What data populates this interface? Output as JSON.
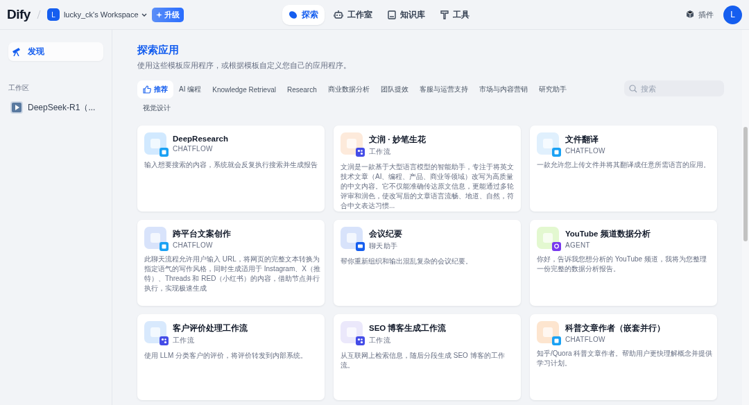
{
  "header": {
    "logo": "Dify",
    "workspace": {
      "initial": "L",
      "name": "lucky_ck's Workspace"
    },
    "upgrade": "升级",
    "nav": [
      {
        "label": "探索",
        "kind": "explore",
        "selected": true
      },
      {
        "label": "工作室",
        "kind": "studio",
        "selected": false
      },
      {
        "label": "知识库",
        "kind": "knowledge",
        "selected": false
      },
      {
        "label": "工具",
        "kind": "tools",
        "selected": false
      }
    ],
    "plugins": "插件",
    "avatar": "L"
  },
  "sidebar": {
    "items": [
      {
        "label": "发现",
        "selected": true
      }
    ],
    "section": "工作区",
    "apps": [
      {
        "label": "DeepSeek-R1（..."
      }
    ]
  },
  "main": {
    "title": "探索应用",
    "subtitle": "使用这些模板应用程序，或根据模板自定义您自己的应用程序。",
    "categories": [
      {
        "label": "推荐",
        "selected": true
      },
      {
        "label": "AI 编程",
        "selected": false
      },
      {
        "label": "Knowledge Retrieval",
        "selected": false
      },
      {
        "label": "Research",
        "selected": false
      },
      {
        "label": "商业数据分析",
        "selected": false
      },
      {
        "label": "团队提效",
        "selected": false
      },
      {
        "label": "客服与运营支持",
        "selected": false
      },
      {
        "label": "市场与内容营销",
        "selected": false
      },
      {
        "label": "研究助手",
        "selected": false
      },
      {
        "label": "视觉设计",
        "selected": false
      }
    ],
    "search": {
      "placeholder": "搜索"
    },
    "apps": [
      {
        "name": "DeepResearch",
        "type": "CHATFLOW",
        "kind": "chatflow",
        "color": "#d1e9ff",
        "description": "输入想要搜索的内容，系统就会反复执行搜索并生成报告"
      },
      {
        "name": "文润 · 妙笔生花",
        "type": "工作流",
        "kind": "workflow",
        "color": "#fdeadb",
        "description": "文润是一款基于大型语言模型的智能助手，专注于将英文技术文章（AI、编程、产品、商业等领域）改写为高质量的中文内容。它不仅能准确传达原文信息，更能通过多轮评审和润色，使改写后的文章语言流畅、地道、自然，符合中文表达习惯..."
      },
      {
        "name": "文件翻译",
        "type": "CHATFLOW",
        "kind": "chatflow",
        "color": "#e0f0fd",
        "description": "一款允许您上传文件并将其翻译成任意所需语言的应用。"
      },
      {
        "name": "跨平台文案创作",
        "type": "CHATFLOW",
        "kind": "chatflow",
        "color": "#d8e3fb",
        "description": "此聊天流程允许用户输入 URL，将网页的完整文本转换为指定语气的写作风格，同时生成适用于 Instagram、X（推特）、Threads 和 RED（小红书）的内容，借助节点并行执行，实现极速生成"
      },
      {
        "name": "会议纪要",
        "type": "聊天助手",
        "kind": "chatbot",
        "color": "#d8e3fb",
        "description": "帮你重新组织和输出混乱复杂的会议纪要。"
      },
      {
        "name": "YouTube 频道数据分析",
        "type": "AGENT",
        "kind": "agent",
        "color": "#e3f8d0",
        "description": "你好，告诉我您想分析的 YouTube 频道，我将为您整理一份完整的数据分析报告。"
      },
      {
        "name": "客户评价处理工作流",
        "type": "工作流",
        "kind": "workflow",
        "color": "#d8e9fd",
        "description": "使用 LLM 分类客户的评价，将评价转发到内部系统。"
      },
      {
        "name": "SEO 博客生成工作流",
        "type": "工作流",
        "kind": "workflow",
        "color": "#ebe8fb",
        "description": "从互联网上检索信息，随后分段生成 SEO 博客的工作流。"
      },
      {
        "name": "科普文章作者（嵌套并行）",
        "type": "CHATFLOW",
        "kind": "chatflow",
        "color": "#fde5cf",
        "description": "知乎/Quora 科普文章作者。帮助用户更快理解概念并提供学习计划。"
      }
    ]
  }
}
